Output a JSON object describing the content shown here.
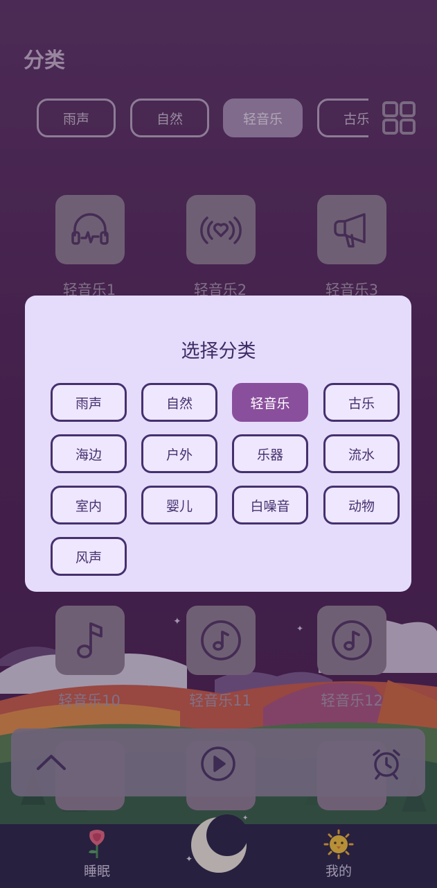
{
  "header": {
    "title": "分类"
  },
  "category_chips": [
    {
      "label": "雨声",
      "active": false
    },
    {
      "label": "自然",
      "active": false
    },
    {
      "label": "轻音乐",
      "active": true
    },
    {
      "label": "古乐",
      "active": false
    }
  ],
  "grid_toggle": {
    "icon": "grid-icon"
  },
  "tracks": [
    {
      "label": "轻音乐1",
      "icon": "headphones-icon"
    },
    {
      "label": "轻音乐2",
      "icon": "heart-broadcast-icon"
    },
    {
      "label": "轻音乐3",
      "icon": "megaphone-icon"
    },
    {
      "label": "轻音乐10",
      "icon": "music-note-icon"
    },
    {
      "label": "轻音乐11",
      "icon": "music-disc-icon"
    },
    {
      "label": "轻音乐12",
      "icon": "music-disc-icon"
    }
  ],
  "dialog": {
    "title": "选择分类",
    "options": [
      {
        "label": "雨声",
        "selected": false
      },
      {
        "label": "自然",
        "selected": false
      },
      {
        "label": "轻音乐",
        "selected": true
      },
      {
        "label": "古乐",
        "selected": false
      },
      {
        "label": "海边",
        "selected": false
      },
      {
        "label": "户外",
        "selected": false
      },
      {
        "label": "乐器",
        "selected": false
      },
      {
        "label": "流水",
        "selected": false
      },
      {
        "label": "室内",
        "selected": false
      },
      {
        "label": "婴儿",
        "selected": false
      },
      {
        "label": "白噪音",
        "selected": false
      },
      {
        "label": "动物",
        "selected": false
      },
      {
        "label": "风声",
        "selected": false
      }
    ]
  },
  "player": {
    "expand_icon": "chevron-up-icon",
    "play_icon": "play-icon",
    "alarm_icon": "alarm-clock-icon"
  },
  "tabbar": {
    "items": [
      {
        "label": "睡眠",
        "icon": "rose-icon"
      },
      {
        "label": "我的",
        "icon": "sun-chick-icon"
      }
    ],
    "center_icon": "moon-icon"
  },
  "colors": {
    "background": "#4a1d56",
    "dialog_background": "#e5dcfb",
    "selected_option": "#8a4f9c",
    "option_border": "#45306e",
    "tabbar": "#1d1a3d"
  }
}
